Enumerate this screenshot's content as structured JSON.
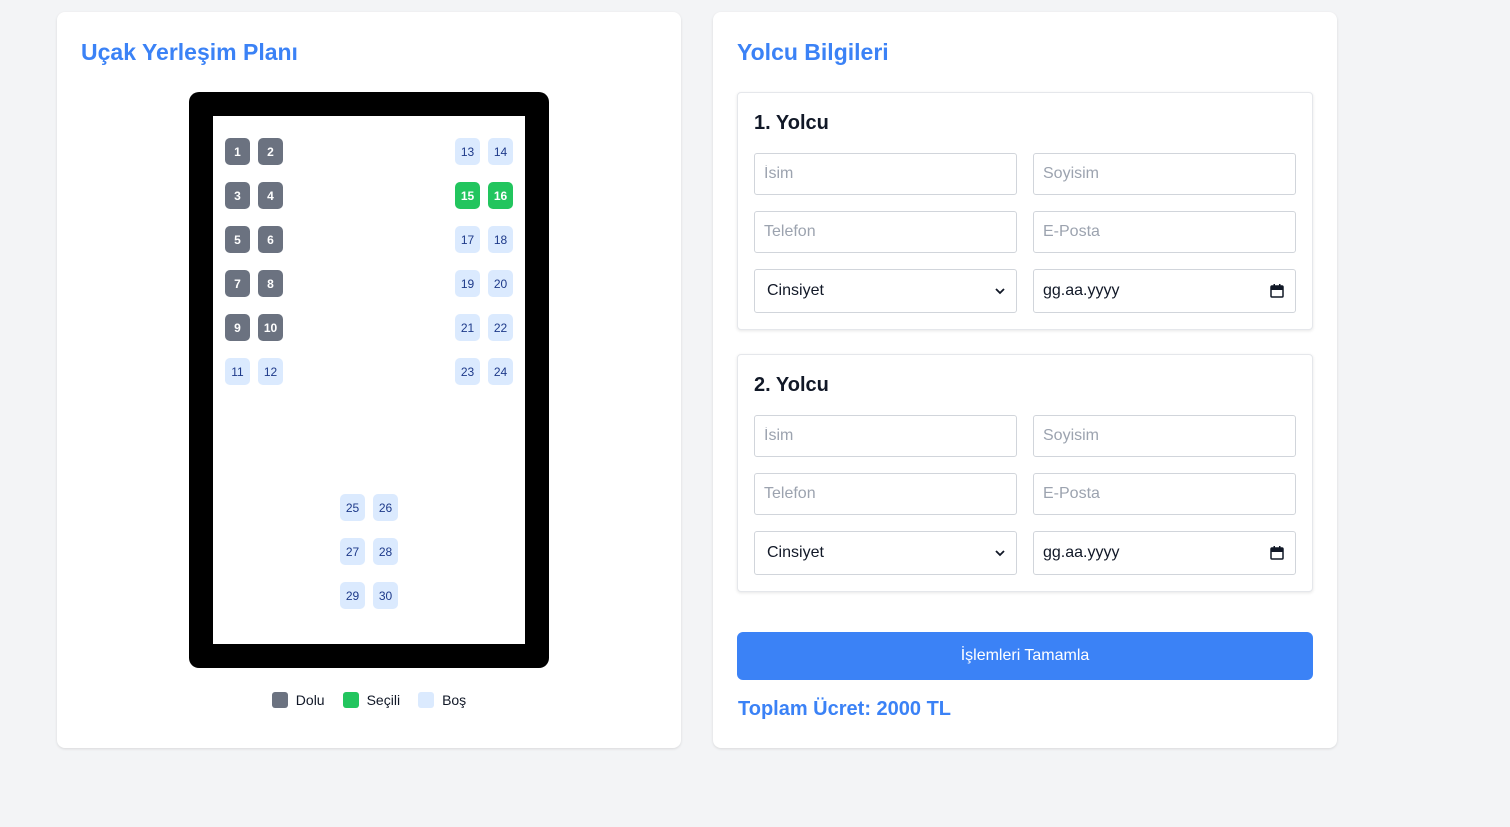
{
  "seat_map": {
    "title": "Uçak Yerleşim Planı",
    "seats": [
      {
        "label": "1",
        "status": "occupied"
      },
      {
        "label": "2",
        "status": "occupied"
      },
      {
        "label": "3",
        "status": "occupied"
      },
      {
        "label": "4",
        "status": "occupied"
      },
      {
        "label": "5",
        "status": "occupied"
      },
      {
        "label": "6",
        "status": "occupied"
      },
      {
        "label": "7",
        "status": "occupied"
      },
      {
        "label": "8",
        "status": "occupied"
      },
      {
        "label": "9",
        "status": "occupied"
      },
      {
        "label": "10",
        "status": "occupied"
      },
      {
        "label": "11",
        "status": "empty"
      },
      {
        "label": "12",
        "status": "empty"
      },
      {
        "label": "13",
        "status": "empty"
      },
      {
        "label": "14",
        "status": "empty"
      },
      {
        "label": "15",
        "status": "selected"
      },
      {
        "label": "16",
        "status": "selected"
      },
      {
        "label": "17",
        "status": "empty"
      },
      {
        "label": "18",
        "status": "empty"
      },
      {
        "label": "19",
        "status": "empty"
      },
      {
        "label": "20",
        "status": "empty"
      },
      {
        "label": "21",
        "status": "empty"
      },
      {
        "label": "22",
        "status": "empty"
      },
      {
        "label": "23",
        "status": "empty"
      },
      {
        "label": "24",
        "status": "empty"
      },
      {
        "label": "25",
        "status": "empty"
      },
      {
        "label": "26",
        "status": "empty"
      },
      {
        "label": "27",
        "status": "empty"
      },
      {
        "label": "28",
        "status": "empty"
      },
      {
        "label": "29",
        "status": "empty"
      },
      {
        "label": "30",
        "status": "empty"
      }
    ],
    "legend": [
      {
        "label": "Dolu",
        "color": "#6b7280"
      },
      {
        "label": "Seçili",
        "color": "#22c55e"
      },
      {
        "label": "Boş",
        "color": "#dbeafe"
      }
    ]
  },
  "passenger_info": {
    "title": "Yolcu Bilgileri",
    "passengers": [
      {
        "title": "1. Yolcu",
        "first_name_placeholder": "İsim",
        "last_name_placeholder": "Soyisim",
        "phone_placeholder": "Telefon",
        "email_placeholder": "E-Posta",
        "gender_selected": "Cinsiyet",
        "date_placeholder": "gg.aa.yyyy"
      },
      {
        "title": "2. Yolcu",
        "first_name_placeholder": "İsim",
        "last_name_placeholder": "Soyisim",
        "phone_placeholder": "Telefon",
        "email_placeholder": "E-Posta",
        "gender_selected": "Cinsiyet",
        "date_placeholder": "gg.aa.yyyy"
      }
    ],
    "submit_label": "İşlemleri Tamamla",
    "total_text": "Toplam Ücret: 2000 TL"
  },
  "colors": {
    "accent": "#3b82f6",
    "occupied": "#6b7280",
    "selected": "#22c55e",
    "empty": "#dbeafe"
  }
}
